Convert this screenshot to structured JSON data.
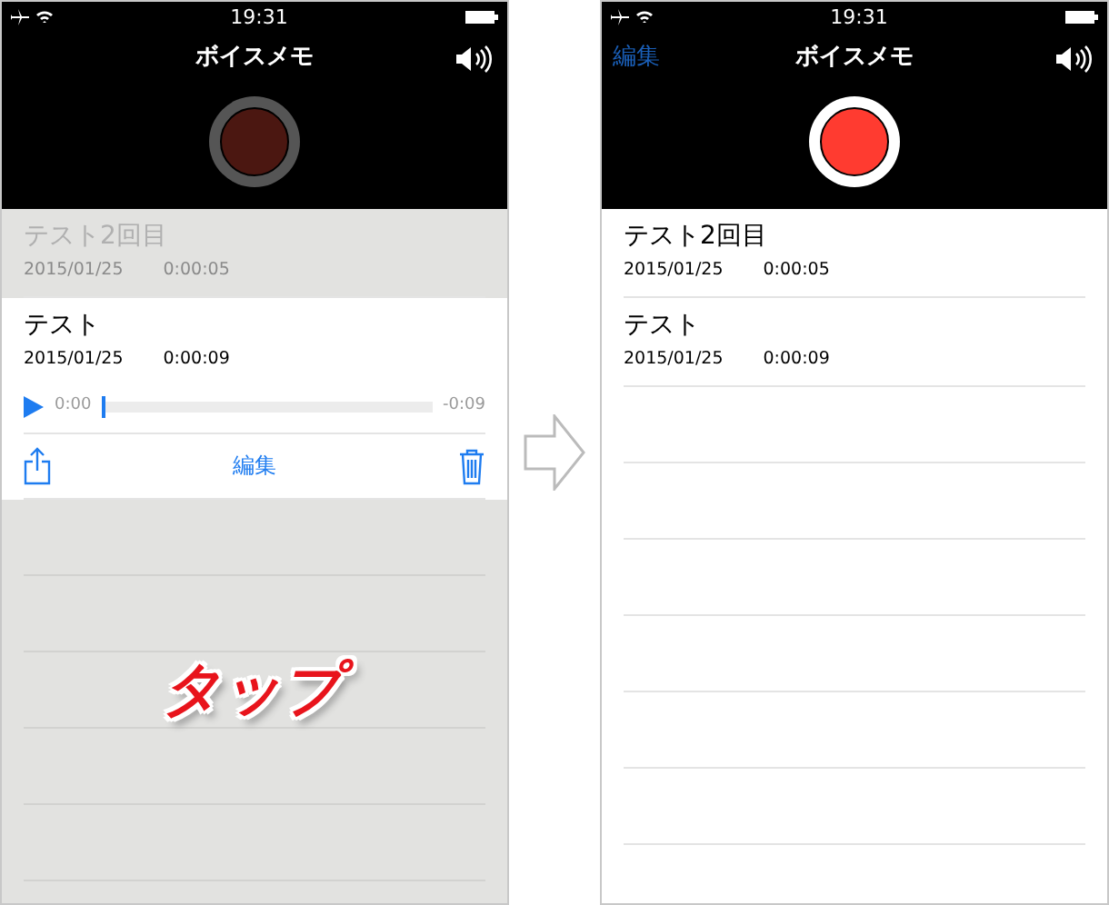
{
  "screens": [
    {
      "status_time": "19:31",
      "title": "ボイスメモ",
      "record_enabled": false,
      "dimmed": true,
      "recordings": [
        {
          "name": "テスト2回目",
          "date": "2015/01/25",
          "duration": "0:00:05",
          "selected": false
        },
        {
          "name": "テスト",
          "date": "2015/01/25",
          "duration": "0:00:09",
          "selected": true,
          "player": {
            "elapsed": "0:00",
            "remaining": "-0:09",
            "level": 0
          },
          "edit_label": "編集"
        }
      ],
      "callout": "タップ"
    },
    {
      "status_time": "19:31",
      "nav_edit": "編集",
      "title": "ボイスメモ",
      "record_enabled": true,
      "dimmed": false,
      "recordings": [
        {
          "name": "テスト2回目",
          "date": "2015/01/25",
          "duration": "0:00:05",
          "selected": false
        },
        {
          "name": "テスト",
          "date": "2015/01/25",
          "duration": "0:00:09",
          "selected": false
        }
      ]
    }
  ]
}
